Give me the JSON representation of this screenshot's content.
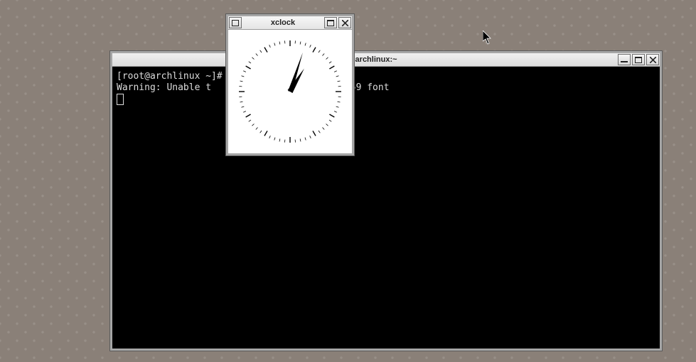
{
  "terminal": {
    "title": "root@archlinux:~",
    "lines": {
      "l1": "[root@archlinux ~]# xclock &",
      "l2_left": "Warning: Unable t",
      "l2_right": "SO8859 font"
    }
  },
  "xclock": {
    "title": "xclock",
    "time": {
      "hour": 1,
      "minute": 3
    }
  },
  "buttons": {
    "menu": "menu",
    "minimize": "minimize",
    "maximize": "maximize",
    "close": "close"
  }
}
